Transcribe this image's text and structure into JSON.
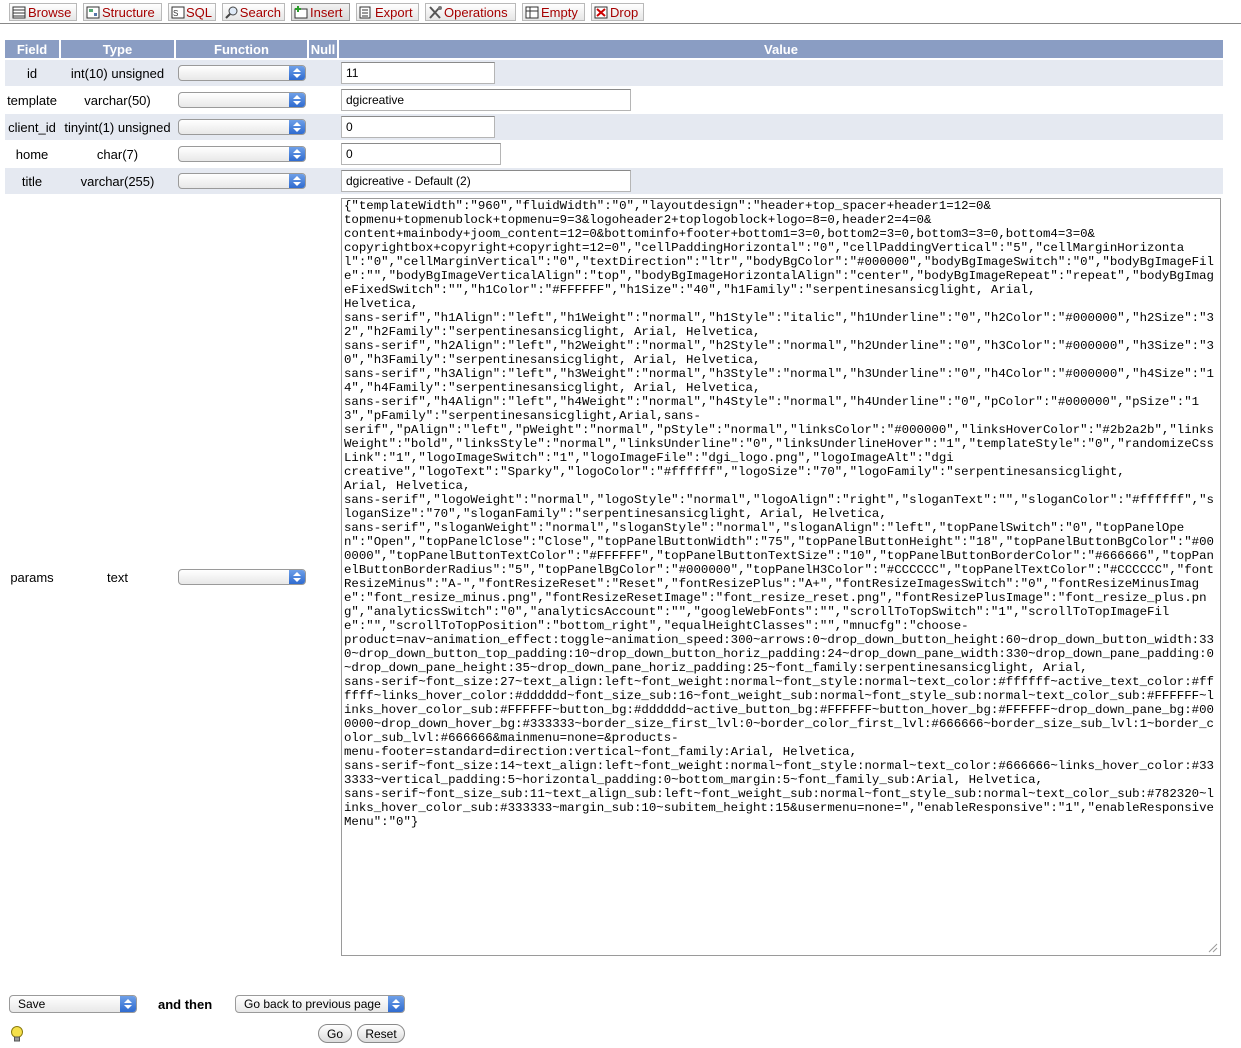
{
  "tabs": [
    {
      "label": "Browse",
      "icon": "browse-icon"
    },
    {
      "label": "Structure",
      "icon": "structure-icon"
    },
    {
      "label": "SQL",
      "icon": "sql-icon"
    },
    {
      "label": "Search",
      "icon": "search-icon"
    },
    {
      "label": "Insert",
      "icon": "insert-icon",
      "active": true
    },
    {
      "label": "Export",
      "icon": "export-icon"
    },
    {
      "label": "Operations",
      "icon": "operations-icon"
    },
    {
      "label": "Empty",
      "icon": "empty-icon"
    },
    {
      "label": "Drop",
      "icon": "drop-icon"
    }
  ],
  "table": {
    "headers": {
      "field": "Field",
      "type": "Type",
      "function": "Function",
      "null": "Null",
      "value": "Value"
    },
    "rows": [
      {
        "field": "id",
        "type": "int(10) unsigned",
        "value": "11"
      },
      {
        "field": "template",
        "type": "varchar(50)",
        "value": "dgicreative"
      },
      {
        "field": "client_id",
        "type": "tinyint(1) unsigned",
        "value": "0"
      },
      {
        "field": "home",
        "type": "char(7)",
        "value": "0"
      },
      {
        "field": "title",
        "type": "varchar(255)",
        "value": "dgicreative - Default (2)"
      },
      {
        "field": "params",
        "type": "text",
        "value": "{\"templateWidth\":\"960\",\"fluidWidth\":\"0\",\"layoutdesign\":\"header+top_spacer+header1=12=0&\ntopmenu+topmenublock+topmenu=9=3&logoheader2+toplogoblock+logo=8=0,header2=4=0&\ncontent+mainbody+joom_content=12=0&bottominfo+footer+bottom1=3=0,bottom2=3=0,bottom3=3=0,bottom4=3=0&\ncopyrightbox+copyright+copyright=12=0\",\"cellPaddingHorizontal\":\"0\",\"cellPaddingVertical\":\"5\",\"cellMarginHorizontal\":\"0\",\"cellMarginVertical\":\"0\",\"textDirection\":\"ltr\",\"bodyBgColor\":\"#000000\",\"bodyBgImageSwitch\":\"0\",\"bodyBgImageFile\":\"\",\"bodyBgImageVerticalAlign\":\"top\",\"bodyBgImageHorizontalAlign\":\"center\",\"bodyBgImageRepeat\":\"repeat\",\"bodyBgImageFixedSwitch\":\"\",\"h1Color\":\"#FFFFFF\",\"h1Size\":\"40\",\"h1Family\":\"serpentinesansicglight, Arial,\nHelvetica,\nsans-serif\",\"h1Align\":\"left\",\"h1Weight\":\"normal\",\"h1Style\":\"italic\",\"h1Underline\":\"0\",\"h2Color\":\"#000000\",\"h2Size\":\"32\",\"h2Family\":\"serpentinesansicglight, Arial, Helvetica,\nsans-serif\",\"h2Align\":\"left\",\"h2Weight\":\"normal\",\"h2Style\":\"normal\",\"h2Underline\":\"0\",\"h3Color\":\"#000000\",\"h3Size\":\"30\",\"h3Family\":\"serpentinesansicglight, Arial, Helvetica,\nsans-serif\",\"h3Align\":\"left\",\"h3Weight\":\"normal\",\"h3Style\":\"normal\",\"h3Underline\":\"0\",\"h4Color\":\"#000000\",\"h4Size\":\"14\",\"h4Family\":\"serpentinesansicglight, Arial, Helvetica,\nsans-serif\",\"h4Align\":\"left\",\"h4Weight\":\"normal\",\"h4Style\":\"normal\",\"h4Underline\":\"0\",\"pColor\":\"#000000\",\"pSize\":\"13\",\"pFamily\":\"serpentinesansicglight,Arial,sans-\nserif\",\"pAlign\":\"left\",\"pWeight\":\"normal\",\"pStyle\":\"normal\",\"linksColor\":\"#000000\",\"linksHoverColor\":\"#2b2a2b\",\"linksWeight\":\"bold\",\"linksStyle\":\"normal\",\"linksUnderline\":\"0\",\"linksUnderlineHover\":\"1\",\"templateStyle\":\"0\",\"randomizeCssLink\":\"1\",\"logoImageSwitch\":\"1\",\"logoImageFile\":\"dgi_logo.png\",\"logoImageAlt\":\"dgi\ncreative\",\"logoText\":\"Sparky\",\"logoColor\":\"#ffffff\",\"logoSize\":\"70\",\"logoFamily\":\"serpentinesansicglight,\nArial, Helvetica,\nsans-serif\",\"logoWeight\":\"normal\",\"logoStyle\":\"normal\",\"logoAlign\":\"right\",\"sloganText\":\"\",\"sloganColor\":\"#ffffff\",\"sloganSize\":\"70\",\"sloganFamily\":\"serpentinesansicglight, Arial, Helvetica,\nsans-serif\",\"sloganWeight\":\"normal\",\"sloganStyle\":\"normal\",\"sloganAlign\":\"left\",\"topPanelSwitch\":\"0\",\"topPanelOpen\":\"Open\",\"topPanelClose\":\"Close\",\"topPanelButtonWidth\":\"75\",\"topPanelButtonHeight\":\"18\",\"topPanelButtonBgColor\":\"#000000\",\"topPanelButtonTextColor\":\"#FFFFFF\",\"topPanelButtonTextSize\":\"10\",\"topPanelButtonBorderColor\":\"#666666\",\"topPanelButtonBorderRadius\":\"5\",\"topPanelBgColor\":\"#000000\",\"topPanelH3Color\":\"#CCCCCC\",\"topPanelTextColor\":\"#CCCCCC\",\"fontResizeMinus\":\"A-\",\"fontResizeReset\":\"Reset\",\"fontResizePlus\":\"A+\",\"fontResizeImagesSwitch\":\"0\",\"fontResizeMinusImage\":\"font_resize_minus.png\",\"fontResizeResetImage\":\"font_resize_reset.png\",\"fontResizePlusImage\":\"font_resize_plus.png\",\"analyticsSwitch\":\"0\",\"analyticsAccount\":\"\",\"googleWebFonts\":\"\",\"scrollToTopSwitch\":\"1\",\"scrollToTopImageFile\":\"\",\"scrollToTopPosition\":\"bottom_right\",\"equalHeightClasses\":\"\",\"mnucfg\":\"choose-\nproduct=nav~animation_effect:toggle~animation_speed:300~arrows:0~drop_down_button_height:60~drop_down_button_width:330~drop_down_button_top_padding:10~drop_down_button_horiz_padding:24~drop_down_pane_width:330~drop_down_pane_padding:0~drop_down_pane_height:35~drop_down_pane_horiz_padding:25~font_family:serpentinesansicglight, Arial,\nsans-serif~font_size:27~text_align:left~font_weight:normal~font_style:normal~text_color:#ffffff~active_text_color:#ffffff~links_hover_color:#dddddd~font_size_sub:16~font_weight_sub:normal~font_style_sub:normal~text_color_sub:#FFFFFF~links_hover_color_sub:#FFFFFF~button_bg:#dddddd~active_button_bg:#FFFFFF~button_hover_bg:#FFFFFF~drop_down_pane_bg:#000000~drop_down_hover_bg:#333333~border_size_first_lvl:0~border_color_first_lvl:#666666~border_size_sub_lvl:1~border_color_sub_lvl:#666666&mainmenu=none=&products-\nmenu-footer=standard=direction:vertical~font_family:Arial, Helvetica,\nsans-serif~font_size:14~text_align:left~font_weight:normal~font_style:normal~text_color:#666666~links_hover_color:#333333~vertical_padding:5~horizontal_padding:0~bottom_margin:5~font_family_sub:Arial, Helvetica,\nsans-serif~font_size_sub:11~text_align_sub:left~font_weight_sub:normal~font_style_sub:normal~text_color_sub:#782320~links_hover_color_sub:#333333~margin_sub:10~subitem_height:15&usermenu=none=\",\"enableResponsive\":\"1\",\"enableResponsiveMenu\":\"0\"}"
      }
    ]
  },
  "footer": {
    "action_select": "Save",
    "and_then_label": "and then",
    "after_select": "Go back to previous page",
    "go_label": "Go",
    "reset_label": "Reset",
    "hint_icon": "lightbulb-icon"
  },
  "colors": {
    "header_bg": "#8a9dc3",
    "row_alt_bg": "#e5e9f1",
    "tab_text": "#a50000"
  }
}
